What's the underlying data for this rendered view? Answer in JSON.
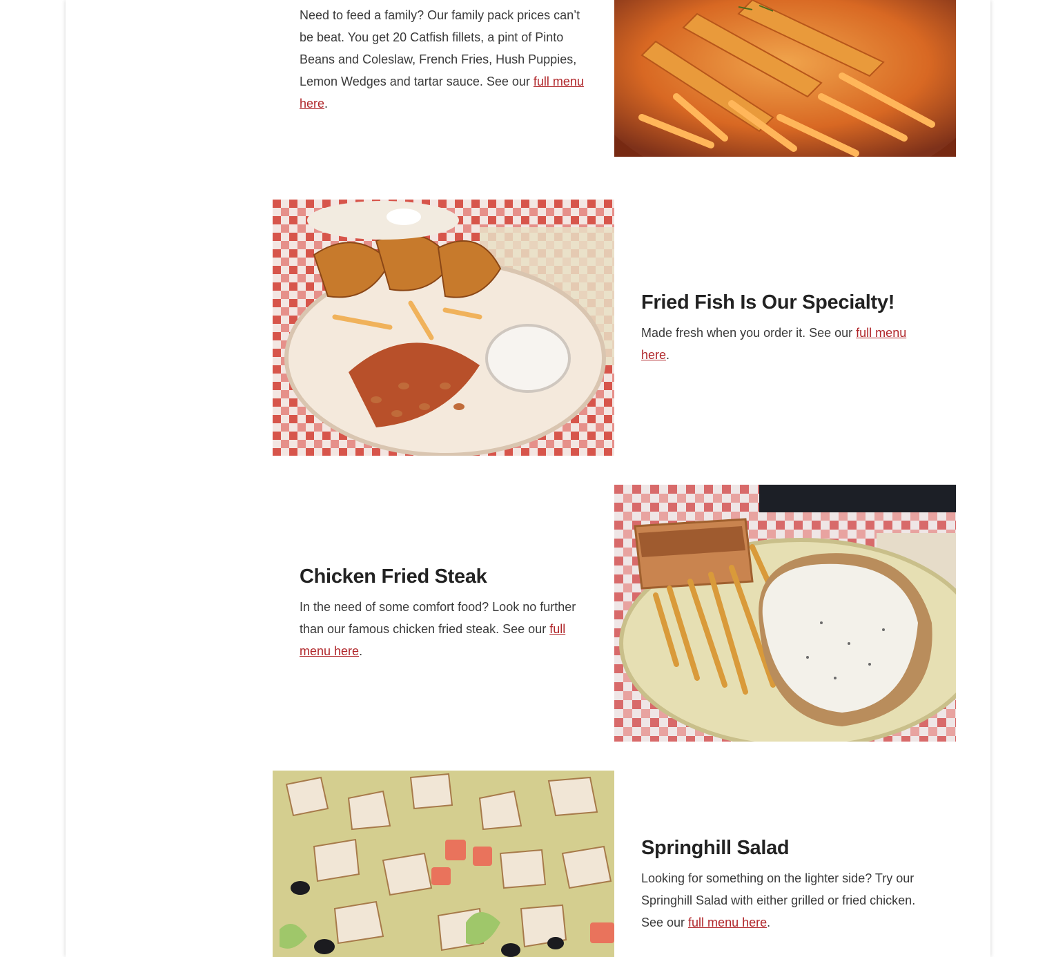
{
  "sections": [
    {
      "title": "",
      "text_before_link": "Need to feed a family? Our family pack prices can’t be beat. You get 20 Catfish fillets, a pint of Pinto Beans and Coleslaw, French Fries, Hush Puppies, Lemon Wedges and tartar sauce. See our ",
      "link_text": "full menu here",
      "text_after_link": ".",
      "image_subject": "fried catfish fillets with french fries"
    },
    {
      "title": "Fried Fish Is Our Specialty!",
      "text_before_link": "Made fresh when you order it. See our ",
      "link_text": "full menu here",
      "text_after_link": ".",
      "image_subject": "fried fish plate with pinto beans and fries"
    },
    {
      "title": "Chicken Fried Steak",
      "text_before_link": "In the need of some comfort food? Look no further than our famous chicken fried steak. See our ",
      "link_text": "full menu here",
      "text_after_link": ".",
      "image_subject": "chicken fried steak with gravy, toast and fries"
    },
    {
      "title": "Springhill Salad",
      "text_before_link": "Looking for something on the lighter side? Try our Springhill Salad with either grilled or fried chicken. See our ",
      "link_text": "full menu here",
      "text_after_link": ".",
      "image_subject": "salad with grilled chicken, tomatoes and olives"
    }
  ],
  "colors": {
    "link": "#b0262a",
    "heading": "#222222",
    "body_text": "#3a3a3a"
  }
}
